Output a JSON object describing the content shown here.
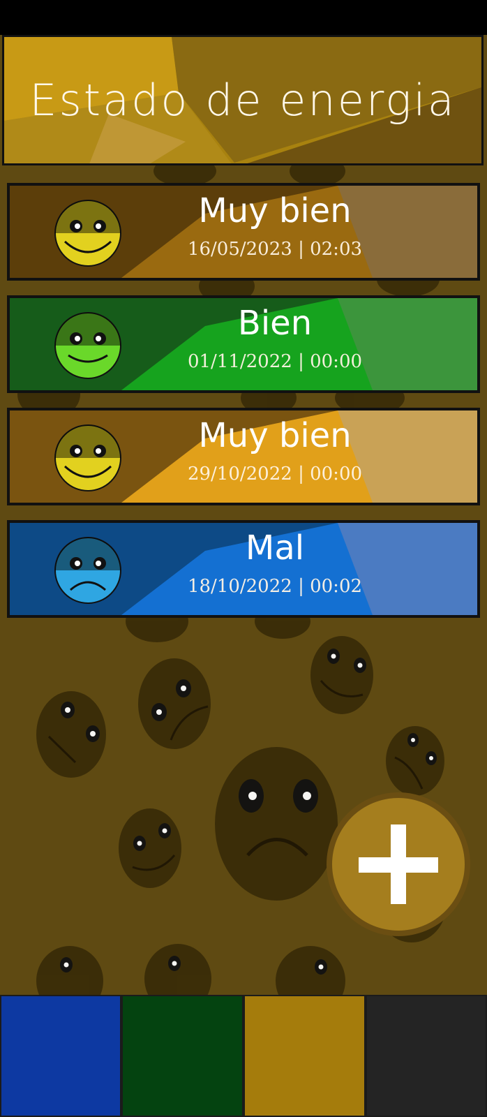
{
  "header": {
    "title": "Estado de energia"
  },
  "entries": [
    {
      "mood": "Muy bien",
      "datetime": "16/05/2023 | 02:03",
      "face": "happy-face-icon",
      "colors": {
        "dark": "#5c3e0a",
        "mid": "#9a6a10",
        "light": "#8a6c3a",
        "face": "#e2d11f"
      }
    },
    {
      "mood": "Bien",
      "datetime": "01/11/2022 | 00:00",
      "face": "smile-face-icon",
      "colors": {
        "dark": "#165c1a",
        "mid": "#16a31e",
        "light": "#3c953c",
        "face": "#6ad82a"
      }
    },
    {
      "mood": "Muy bien",
      "datetime": "29/10/2022 | 00:00",
      "face": "happy-face-icon",
      "colors": {
        "dark": "#7a5410",
        "mid": "#e1a01a",
        "light": "#c9a256",
        "face": "#e2d11f"
      }
    },
    {
      "mood": "Mal",
      "datetime": "18/10/2022 | 00:02",
      "face": "sad-face-icon",
      "colors": {
        "dark": "#0d4a86",
        "mid": "#1470d2",
        "light": "#4b7bc2",
        "face": "#2fa6e2"
      }
    }
  ],
  "fab": {
    "icon": "plus-icon",
    "color": "#a57e1e"
  },
  "navbar": {
    "tabs": [
      {
        "name": "nav-tab-blue",
        "color": "#0d39a2"
      },
      {
        "name": "nav-tab-green",
        "color": "#044310"
      },
      {
        "name": "nav-tab-gold",
        "color": "#a57c0c"
      },
      {
        "name": "nav-tab-dark",
        "color": "#242424"
      }
    ]
  }
}
